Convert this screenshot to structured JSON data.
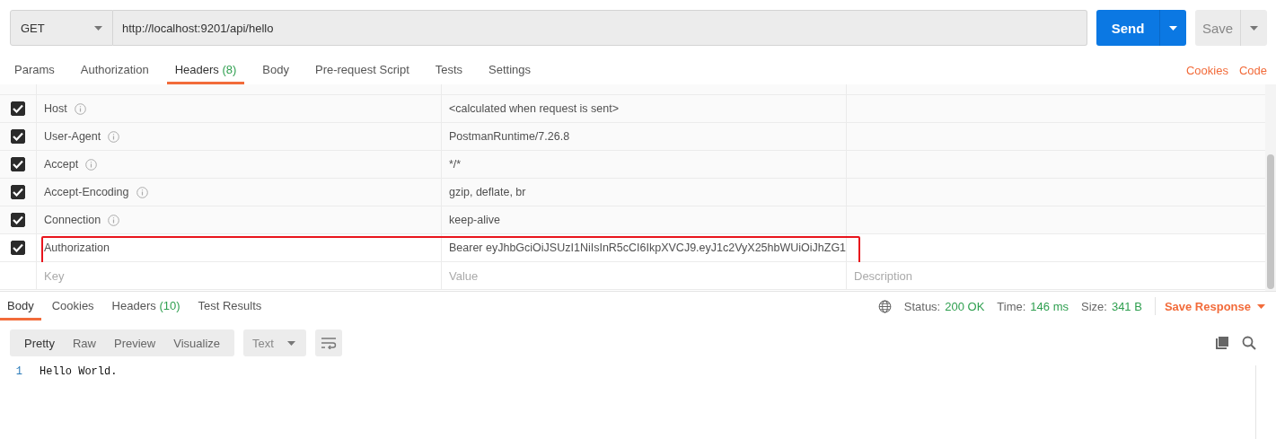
{
  "request": {
    "method": "GET",
    "url": "http://localhost:9201/api/hello",
    "send": "Send",
    "save": "Save"
  },
  "request_tabs": [
    {
      "label": "Params",
      "selected": false
    },
    {
      "label": "Authorization",
      "selected": false
    },
    {
      "label": "Headers",
      "count": "(8)",
      "selected": true
    },
    {
      "label": "Body",
      "selected": false
    },
    {
      "label": "Pre-request Script",
      "selected": false
    },
    {
      "label": "Tests",
      "selected": false
    },
    {
      "label": "Settings",
      "selected": false
    }
  ],
  "request_links": [
    "Cookies",
    "Code"
  ],
  "headers": [
    {
      "key": "Host",
      "value": "<calculated when request is sent>",
      "checked": true,
      "auto": true,
      "highlighted": false
    },
    {
      "key": "User-Agent",
      "value": "PostmanRuntime/7.26.8",
      "checked": true,
      "auto": true,
      "highlighted": false
    },
    {
      "key": "Accept",
      "value": "*/*",
      "checked": true,
      "auto": true,
      "highlighted": false
    },
    {
      "key": "Accept-Encoding",
      "value": "gzip, deflate, br",
      "checked": true,
      "auto": true,
      "highlighted": false
    },
    {
      "key": "Connection",
      "value": "keep-alive",
      "checked": true,
      "auto": true,
      "highlighted": false
    },
    {
      "key": "Authorization",
      "value": "Bearer eyJhbGciOiJSUzI1NiIsInR5cCI6IkpXVCJ9.eyJ1c2VyX25hbWUiOiJhZG1",
      "checked": true,
      "auto": false,
      "highlighted": true
    }
  ],
  "new_header": {
    "key_placeholder": "Key",
    "value_placeholder": "Value",
    "description_placeholder": "Description"
  },
  "response_tabs": [
    {
      "label": "Body",
      "selected": true
    },
    {
      "label": "Cookies",
      "selected": false
    },
    {
      "label": "Headers",
      "count": "(10)",
      "selected": false
    },
    {
      "label": "Test Results",
      "selected": false
    }
  ],
  "response_meta": [
    {
      "label": "Status:",
      "value": "200 OK"
    },
    {
      "label": "Time:",
      "value": "146 ms"
    },
    {
      "label": "Size:",
      "value": "341 B"
    }
  ],
  "save_response": "Save Response",
  "view_modes": [
    {
      "label": "Pretty",
      "selected": true
    },
    {
      "label": "Raw",
      "selected": false
    },
    {
      "label": "Preview",
      "selected": false
    },
    {
      "label": "Visualize",
      "selected": false
    }
  ],
  "format": "Text",
  "body_lines": [
    {
      "number": "1",
      "text": "Hello World."
    }
  ]
}
